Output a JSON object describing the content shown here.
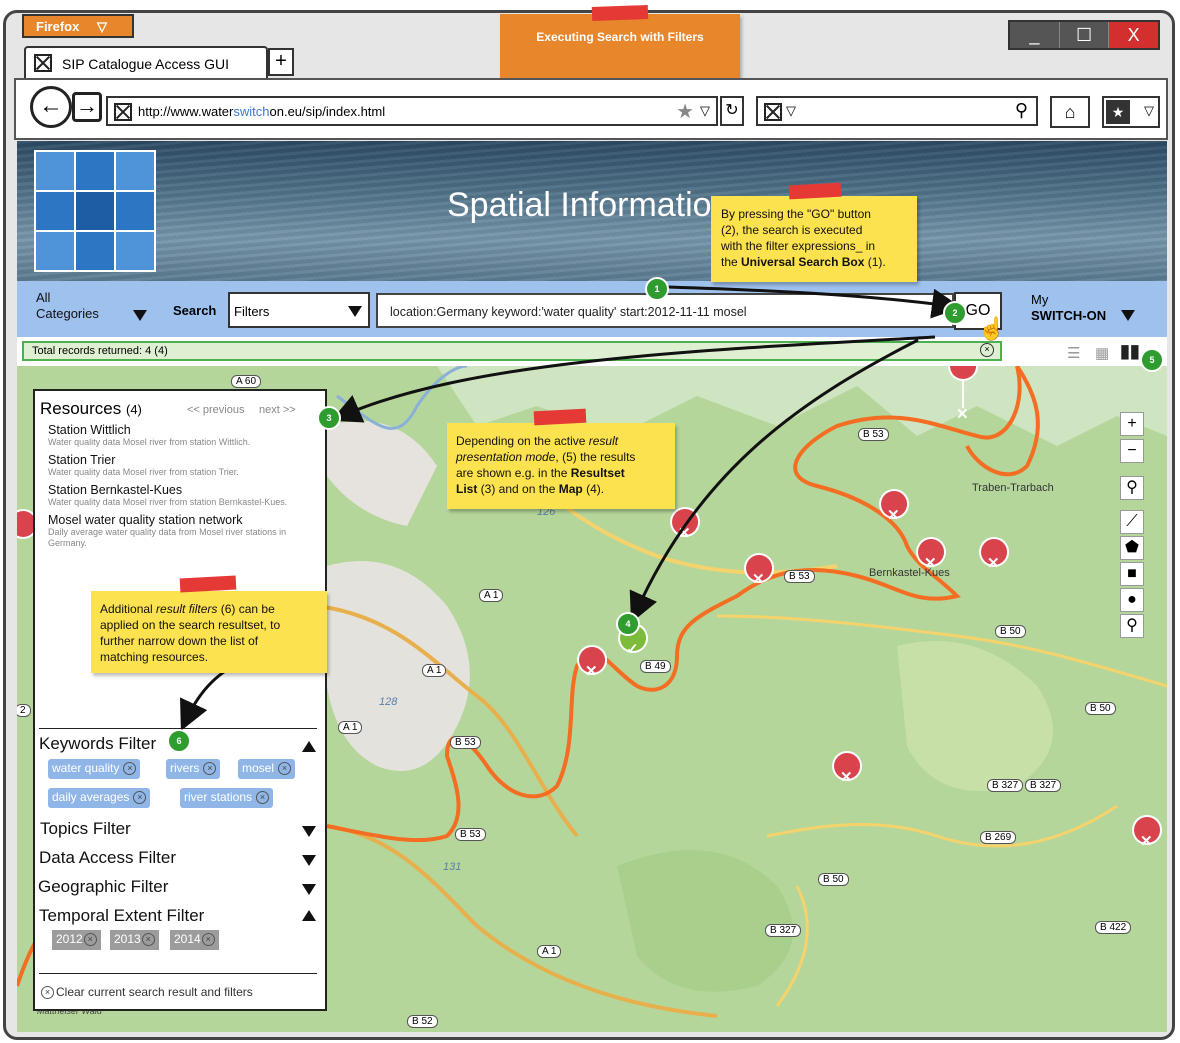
{
  "browser": {
    "app_button": "Firefox",
    "tab_title": "SIP Catalogue Access GUI",
    "new_tab": "+",
    "url_prefix": "http://www.water",
    "url_highlight": "switch",
    "url_middle": "on.eu/sip/index.html",
    "window_controls": [
      "_",
      "☐",
      "X"
    ]
  },
  "header_note": "Executing Search with Filters",
  "banner": {
    "title": "Spatial Informatio"
  },
  "search": {
    "categories_line1": "All",
    "categories_line2": "Categories",
    "label": "Search",
    "filter_select": "Filters",
    "query": "location:Germany keyword:'water quality' start:2012-11-11 mosel",
    "go_label": "GO",
    "my_line1": "My",
    "my_line2": "SWITCH-ON"
  },
  "records": "Total records returned: 4 (4)",
  "resources": {
    "title": "Resources",
    "count": "(4)",
    "prev": "<< previous",
    "next": "next >>",
    "items": [
      {
        "title": "Station Wittlich",
        "desc": "Water quality data Mosel river from station Wittlich."
      },
      {
        "title": "Station Trier",
        "desc": "Water quality data Mosel river from station Trier."
      },
      {
        "title": "Station Bernkastel-Kues",
        "desc": "Water quality data Mosel river from station Bernkastel-Kues."
      },
      {
        "title": "Mosel water quality station network",
        "desc": "Daily average water quality data from Mosel river stations in Germany."
      }
    ]
  },
  "filters": {
    "keywords": "Keywords Filter",
    "keyword_tags": [
      "water quality",
      "rivers",
      "mosel",
      "daily averages",
      "river stations"
    ],
    "topics": "Topics Filter",
    "data_access": "Data Access Filter",
    "geographic": "Geographic Filter",
    "temporal": "Temporal Extent Filter",
    "years": [
      "2012",
      "2013",
      "2014"
    ],
    "clear": "Clear current search result and filters"
  },
  "notes": {
    "go_note_1": "By pressing the \"GO\" button",
    "go_note_2": "(2), the search is executed",
    "go_note_3": "with the filter expressions_ in",
    "go_note_4a": "the ",
    "go_note_4b": "Universal Search Box",
    "go_note_4c": " (1).",
    "mode_note_1a": "Depending on the active ",
    "mode_note_1b": "result",
    "mode_note_2a": "presentation mode",
    "mode_note_2b": ", (5) the results",
    "mode_note_3a": "are shown e.g. in the ",
    "mode_note_3b": "Resultset",
    "mode_note_4a": "List",
    "mode_note_4b": " (3) and on the ",
    "mode_note_4c": "Map",
    "mode_note_4d": " (4).",
    "filter_note_1a": "Additional ",
    "filter_note_1b": "result filters",
    "filter_note_1c": " (6) can be",
    "filter_note_2": "applied on the search resultset, to",
    "filter_note_3": "further narrow down the list of",
    "filter_note_4": "matching resources."
  },
  "markers": [
    "1",
    "2",
    "3",
    "4",
    "5",
    "6"
  ],
  "map_labels": {
    "roads": [
      "A 60",
      "A 1",
      "A 1",
      "A 1",
      "A 1",
      "B 53",
      "B 53",
      "B 53",
      "B 53",
      "B 50",
      "B 50",
      "B 50",
      "B 327",
      "B 327",
      "B 327",
      "B 269",
      "B 422",
      "B 52",
      "B 49",
      "126",
      "128",
      "131",
      "2"
    ],
    "towns": [
      "Traben-Trarbach",
      "Bernkastel-Kues",
      "Mattheiser Wald"
    ]
  },
  "colors": {
    "river": "#f36d22",
    "strip": "#9ec1ee",
    "note": "#fde24f",
    "tape": "#e53935",
    "marker": "#2e9c2e",
    "pin": "#d9434c"
  },
  "icons": [
    "back-arrow-icon",
    "forward-arrow-icon",
    "star-icon",
    "reload-icon",
    "search-icon",
    "home-icon",
    "bookmark-icon",
    "list-view-icon",
    "grid-view-icon",
    "map-view-icon",
    "zoom-in-icon",
    "zoom-out-icon",
    "line-tool-icon",
    "polygon-tool-icon",
    "rectangle-tool-icon",
    "circle-tool-icon",
    "point-tool-icon"
  ]
}
